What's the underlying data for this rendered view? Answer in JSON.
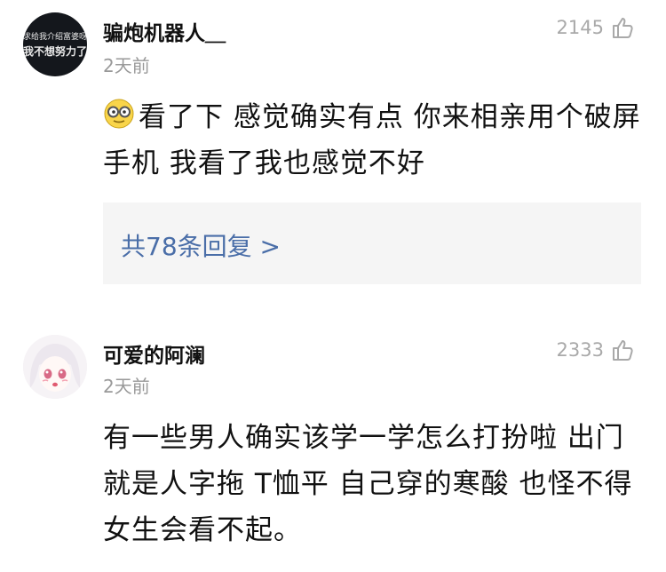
{
  "comments": [
    {
      "username": "骗炮机器人＿",
      "time": "2天前",
      "likes": "2145",
      "text": "看了下 感觉确实有点  你来相亲用个破屏手机  我看了我也感觉不好",
      "replies_label": "共78条回复 >",
      "avatar_text_top": "求给我介绍富婆呀",
      "avatar_text_bottom": "我不想努力了"
    },
    {
      "username": "可爱的阿澜",
      "time": "2天前",
      "likes": "2333",
      "text": "有一些男人确实该学一学怎么打扮啦 出门就是人字拖 T恤平 自己穿的寒酸 也怪不得女生会看不起。"
    }
  ]
}
